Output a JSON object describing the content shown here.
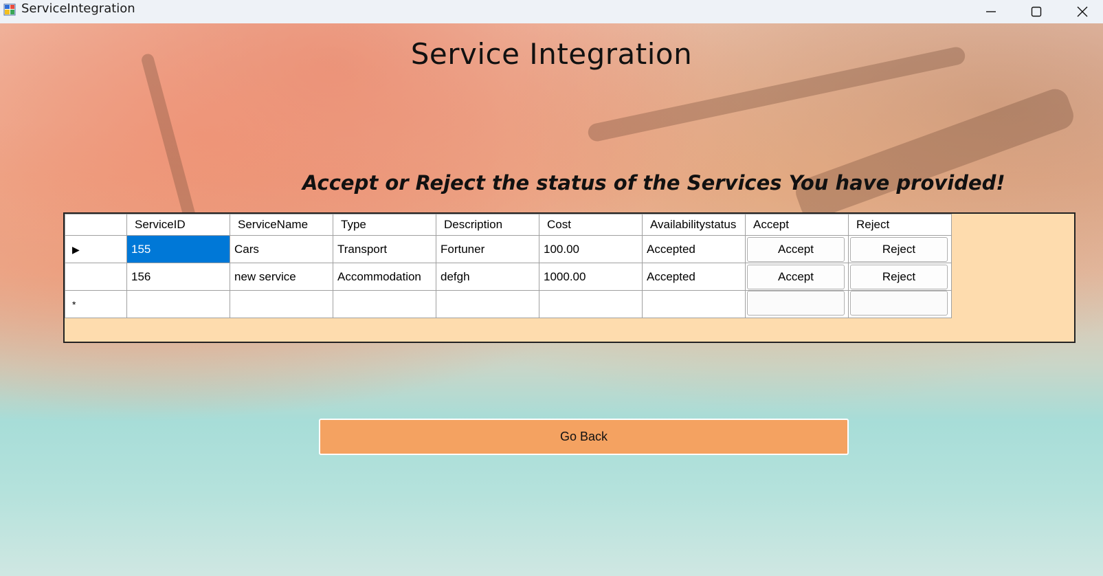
{
  "window": {
    "title": "ServiceIntegration",
    "minimize_icon": "minimize-icon",
    "maximize_icon": "maximize-icon",
    "close_icon": "close-icon"
  },
  "page": {
    "title": "Service Integration",
    "subtitle": "Accept or Reject the status of the Services You have provided!"
  },
  "grid": {
    "columns": [
      "ServiceID",
      "ServiceName",
      "Type",
      "Description",
      "Cost",
      "Availabilitystatus",
      "Accept",
      "Reject"
    ],
    "rows": [
      {
        "marker": "▶",
        "service_id": "155",
        "service_name": "Cars",
        "type": "Transport",
        "description": "Fortuner",
        "cost": "100.00",
        "availability": "Accepted",
        "accept": "Accept",
        "reject": "Reject"
      },
      {
        "marker": "",
        "service_id": "156",
        "service_name": "new service",
        "type": "Accommodation",
        "description": "defgh",
        "cost": "1000.00",
        "availability": "Accepted",
        "accept": "Accept",
        "reject": "Reject"
      }
    ],
    "new_row_marker": "*"
  },
  "buttons": {
    "go_back": "Go Back"
  },
  "colors": {
    "panel_bg": "#fedcae",
    "go_back_bg": "#f4a261",
    "selection": "#0078d7"
  }
}
